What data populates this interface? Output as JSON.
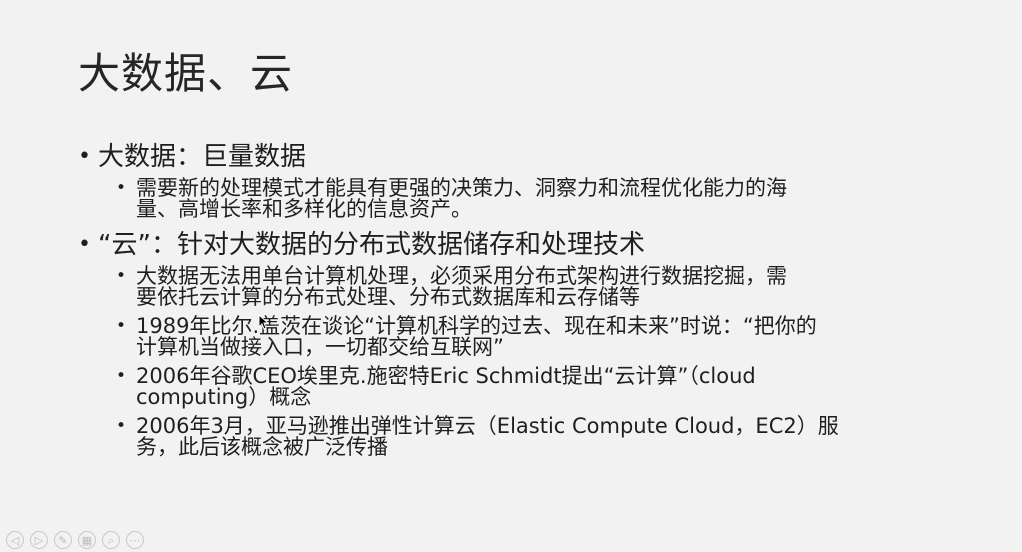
{
  "slide": {
    "title": "大数据、云",
    "sections": [
      {
        "heading": "大数据：巨量数据",
        "items": [
          {
            "lines": [
              "需要新的处理模式才能具有更强的决策力、洞察力和流程优化能力的海",
              "量、高增长率和多样化的信息资产。"
            ]
          }
        ]
      },
      {
        "heading": "“云”：针对大数据的分布式数据储存和处理技术",
        "items": [
          {
            "lines": [
              "大数据无法用单台计算机处理，必须采用分布式架构进行数据挖掘，需",
              "要依托云计算的分布式处理、分布式数据库和云存储等"
            ]
          },
          {
            "lines": [
              "1989年比尔.盖茨在谈论“计算机科学的过去、现在和未来”时说：“把你的",
              "计算机当做接入口，一切都交给互联网”"
            ]
          },
          {
            "lines": [
              "2006年谷歌CEO埃里克.施密特Eric Schmidt提出“云计算”（cloud",
              "computing）概念"
            ]
          },
          {
            "lines": [
              "2006年3月，亚马逊推出弹性计算云（Elastic Compute Cloud，EC2）服",
              "务，此后该概念被广泛传播"
            ]
          }
        ]
      }
    ]
  },
  "toolbar": [
    {
      "name": "previous-slide-icon",
      "glyph": "◁"
    },
    {
      "name": "next-slide-icon",
      "glyph": "▷"
    },
    {
      "name": "pen-icon",
      "glyph": "✎"
    },
    {
      "name": "slides-grid-icon",
      "glyph": "▦"
    },
    {
      "name": "zoom-icon",
      "glyph": "⌕"
    },
    {
      "name": "more-options-icon",
      "glyph": "⋯"
    }
  ]
}
